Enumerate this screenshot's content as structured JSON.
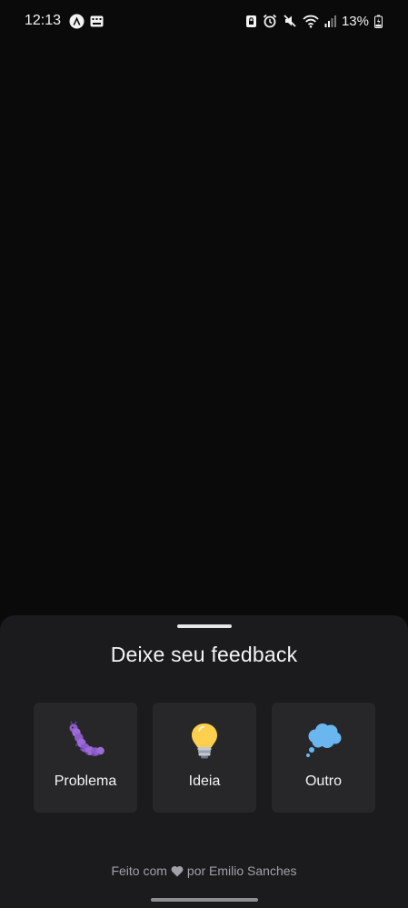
{
  "status_bar": {
    "time": "12:13",
    "battery": "13%"
  },
  "sheet": {
    "title": "Deixe seu feedback",
    "options": [
      {
        "label": "Problema",
        "icon": "caterpillar-icon"
      },
      {
        "label": "Ideia",
        "icon": "lightbulb-icon"
      },
      {
        "label": "Outro",
        "icon": "thought-bubble-icon"
      }
    ],
    "footer_prefix": "Feito com",
    "footer_suffix": "por Emilio Sanches"
  },
  "colors": {
    "background": "#0a0a0a",
    "sheet": "#1b1b1e",
    "card": "#27272a",
    "footer_text": "#a1a1aa"
  }
}
